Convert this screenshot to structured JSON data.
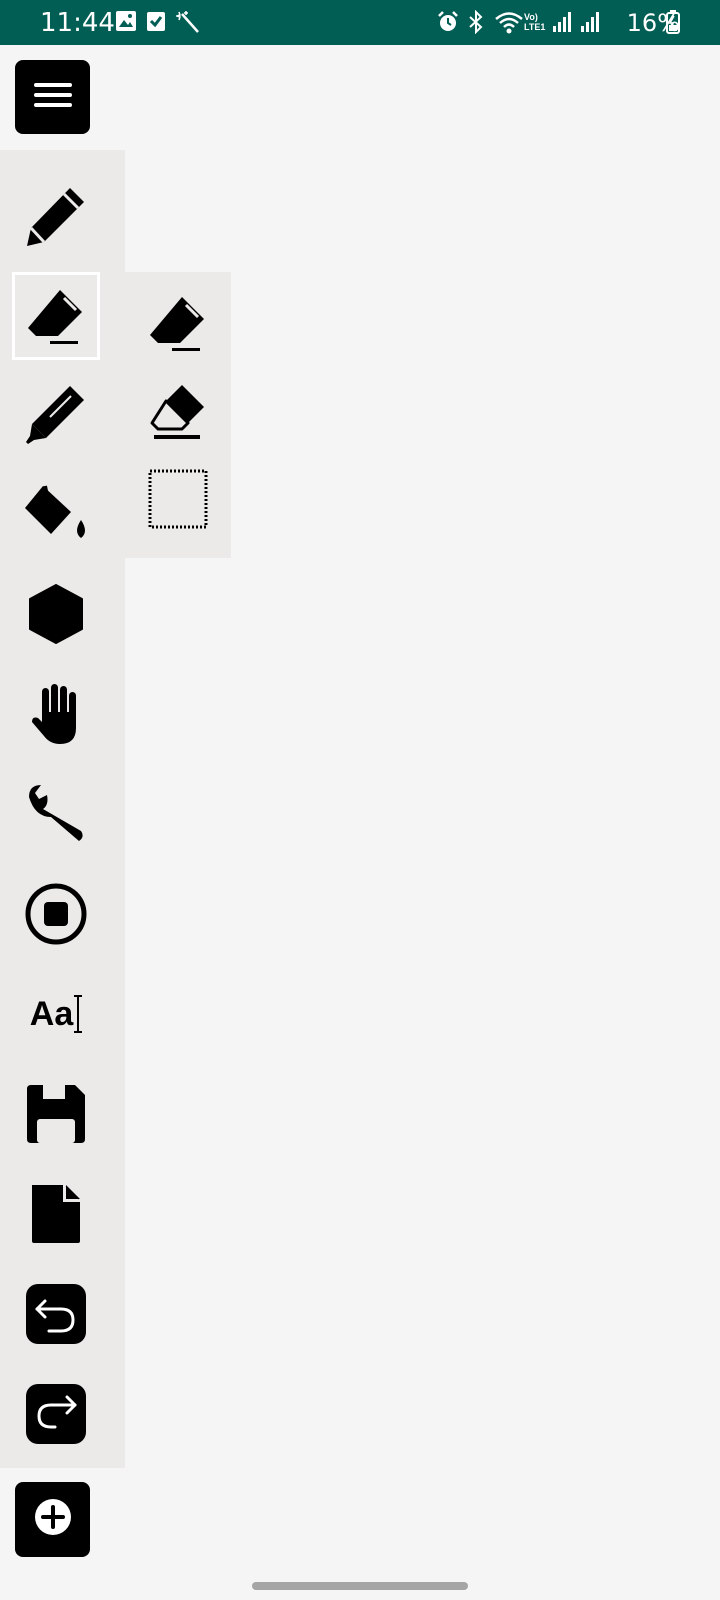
{
  "status_bar": {
    "time": "11:44",
    "network_label": "Vo) LTE1",
    "battery": "16%",
    "background": "#005e54"
  },
  "toolbar": {
    "menu_icon": "hamburger-menu-icon",
    "tools": [
      {
        "id": "pencil",
        "icon": "pencil-icon"
      },
      {
        "id": "eraser",
        "icon": "eraser-icon",
        "selected": true
      },
      {
        "id": "highlighter",
        "icon": "marker-icon"
      },
      {
        "id": "fill",
        "icon": "paint-bucket-icon"
      },
      {
        "id": "shape",
        "icon": "hexagon-icon"
      },
      {
        "id": "pan",
        "icon": "hand-icon"
      },
      {
        "id": "settings",
        "icon": "wrench-icon"
      },
      {
        "id": "record",
        "icon": "stop-circle-icon"
      },
      {
        "id": "text",
        "icon": "text-icon",
        "glyph": "Aa"
      },
      {
        "id": "save",
        "icon": "floppy-disk-icon"
      },
      {
        "id": "new_page",
        "icon": "file-icon"
      },
      {
        "id": "undo",
        "icon": "undo-icon"
      },
      {
        "id": "redo",
        "icon": "redo-icon"
      }
    ],
    "add_icon": "plus-circle-icon"
  },
  "eraser_submenu": {
    "options": [
      {
        "id": "eraser_filled",
        "icon": "eraser-filled-icon"
      },
      {
        "id": "eraser_outline",
        "icon": "eraser-outline-icon"
      },
      {
        "id": "area_select",
        "icon": "dotted-square-icon"
      }
    ]
  },
  "colors": {
    "toolbar_bg": "#ebeae8",
    "canvas_bg": "#f5f5f5",
    "icon": "#000000"
  }
}
